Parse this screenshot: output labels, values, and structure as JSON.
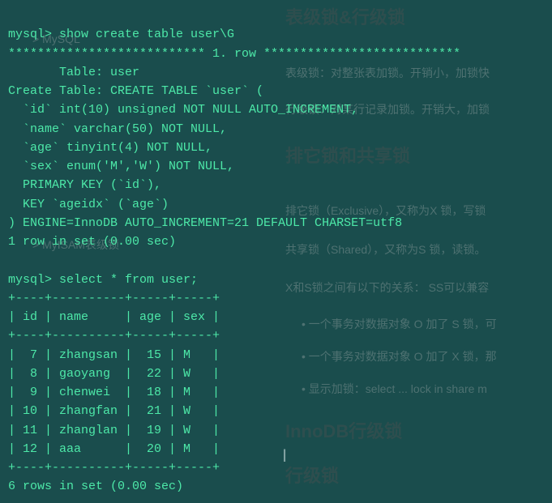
{
  "terminal": {
    "prompt1": "mysql> show create table user\\G",
    "row_header": "*************************** 1. row ***************************",
    "table_line": "       Table: user",
    "create_header": "Create Table: CREATE TABLE `user` (",
    "col_id": "  `id` int(10) unsigned NOT NULL AUTO_INCREMENT,",
    "col_name": "  `name` varchar(50) NOT NULL,",
    "col_age": "  `age` tinyint(4) NOT NULL,",
    "col_sex": "  `sex` enum('M','W') NOT NULL,",
    "pk": "  PRIMARY KEY (`id`),",
    "key": "  KEY `ageidx` (`age`)",
    "engine": ") ENGINE=InnoDB AUTO_INCREMENT=21 DEFAULT CHARSET=utf8",
    "rows1": "1 row in set (0.00 sec)",
    "blank1": "",
    "prompt2": "mysql> select * from user;",
    "tbl_border": "+----+----------+-----+-----+",
    "tbl_head": "| id | name     | age | sex |",
    "r1": "|  7 | zhangsan |  15 | M   |",
    "r2": "|  8 | gaoyang  |  22 | W   |",
    "r3": "|  9 | chenwei  |  18 | M   |",
    "r4": "| 10 | zhangfan |  21 | W   |",
    "r5": "| 11 | zhanglan |  19 | W   |",
    "r6": "| 12 | aaa      |  20 | M   |",
    "rows2": "6 rows in set (0.00 sec)"
  },
  "ghost": {
    "h1": "表级锁&行级锁",
    "p1": "表级锁：对整张表加锁。开销小，加锁快",
    "p2": "行级锁：对某行记录加锁。开销大，加锁",
    "m1": "> MySQL",
    "m2": "> MyISAM表级锁",
    "h2": "排它锁和共享锁",
    "p3": "排它锁（Exclusive），又称为X 锁，写锁",
    "p4": "共享锁（Shared），又称为S 锁，读锁。",
    "p5": "X和S锁之间有以下的关系：   SS可以兼容",
    "li1": "• 一个事务对数据对象 O 加了 S 锁，可",
    "li2": "• 一个事务对数据对象 O 加了 X 锁，那",
    "li3": "• 显示加锁：select ... lock in share m",
    "h3": "InnoDB行级锁",
    "h4": "行级锁"
  },
  "chart_data": {
    "type": "table",
    "title": "user",
    "columns": [
      "id",
      "name",
      "age",
      "sex"
    ],
    "rows": [
      {
        "id": 7,
        "name": "zhangsan",
        "age": 15,
        "sex": "M"
      },
      {
        "id": 8,
        "name": "gaoyang",
        "age": 22,
        "sex": "W"
      },
      {
        "id": 9,
        "name": "chenwei",
        "age": 18,
        "sex": "M"
      },
      {
        "id": 10,
        "name": "zhangfan",
        "age": 21,
        "sex": "W"
      },
      {
        "id": 11,
        "name": "zhanglan",
        "age": 19,
        "sex": "W"
      },
      {
        "id": 12,
        "name": "aaa",
        "age": 20,
        "sex": "M"
      }
    ],
    "row_count": 6,
    "elapsed_sec": 0.0,
    "schema": {
      "id": {
        "type": "int(10) unsigned",
        "null": false,
        "extra": "AUTO_INCREMENT"
      },
      "name": {
        "type": "varchar(50)",
        "null": false
      },
      "age": {
        "type": "tinyint(4)",
        "null": false
      },
      "sex": {
        "type": "enum('M','W')",
        "null": false
      }
    },
    "primary_key": [
      "id"
    ],
    "indexes": [
      {
        "name": "ageidx",
        "columns": [
          "age"
        ]
      }
    ],
    "engine": "InnoDB",
    "auto_increment": 21,
    "charset": "utf8"
  }
}
